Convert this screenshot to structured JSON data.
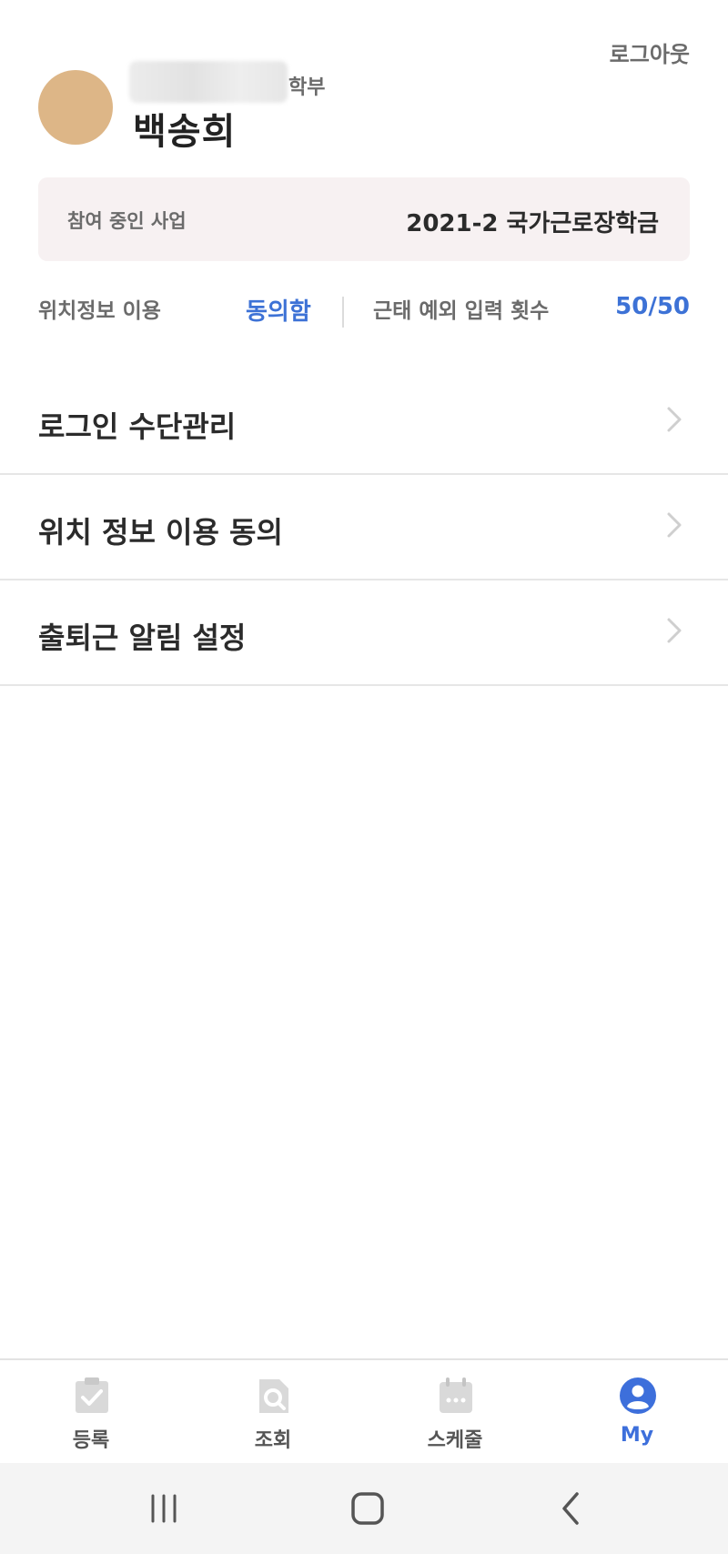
{
  "header": {
    "logout_label": "로그아웃",
    "department_suffix": "학부",
    "user_name": "백송희"
  },
  "program": {
    "label": "참여 중인 사업",
    "value": "2021-2 국가근로장학금"
  },
  "stats": {
    "location_label": "위치정보 이용",
    "location_value": "동의함",
    "attendance_label": "근태 예외 입력 횟수",
    "attendance_value": "50/50"
  },
  "menu": {
    "items": [
      {
        "label": "로그인 수단관리"
      },
      {
        "label": "위치 정보 이용 동의"
      },
      {
        "label": "출퇴근 알림 설정"
      }
    ]
  },
  "bottom_nav": {
    "tabs": [
      {
        "label": "등록",
        "icon": "clipboard-check-icon"
      },
      {
        "label": "조회",
        "icon": "search-document-icon"
      },
      {
        "label": "스케줄",
        "icon": "calendar-icon"
      },
      {
        "label": "My",
        "icon": "user-profile-icon",
        "active": true
      }
    ]
  },
  "colors": {
    "accent": "#3d6fdb",
    "avatar": "#ddb687",
    "program_box_bg": "#f7f1f2"
  }
}
